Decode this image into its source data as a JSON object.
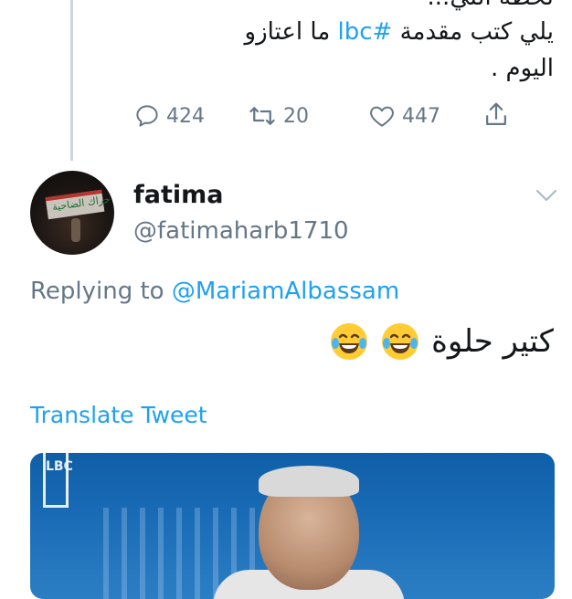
{
  "quoted_tweet": {
    "line0": "لحظة اللي...",
    "line1_prefix": "يلي كتب مقدمة ",
    "hashtag": "#lbc",
    "line1_suffix": " ما اعتازو",
    "line2": "اليوم ."
  },
  "actions": {
    "reply_count": "424",
    "retweet_count": "20",
    "like_count": "447"
  },
  "reply": {
    "display_name": "fatima",
    "handle": "@fatimaharb1710",
    "avatar_banner_text": "حراك الضاحية",
    "replying_prefix": "Replying to ",
    "replying_mention": "@MariamAlbassam",
    "text": "كتير حلوة",
    "translate_label": "Translate Tweet"
  },
  "media": {
    "logo_text": "LBC"
  },
  "colors": {
    "accent": "#1da1f2",
    "muted": "#657786",
    "text": "#14171a"
  }
}
